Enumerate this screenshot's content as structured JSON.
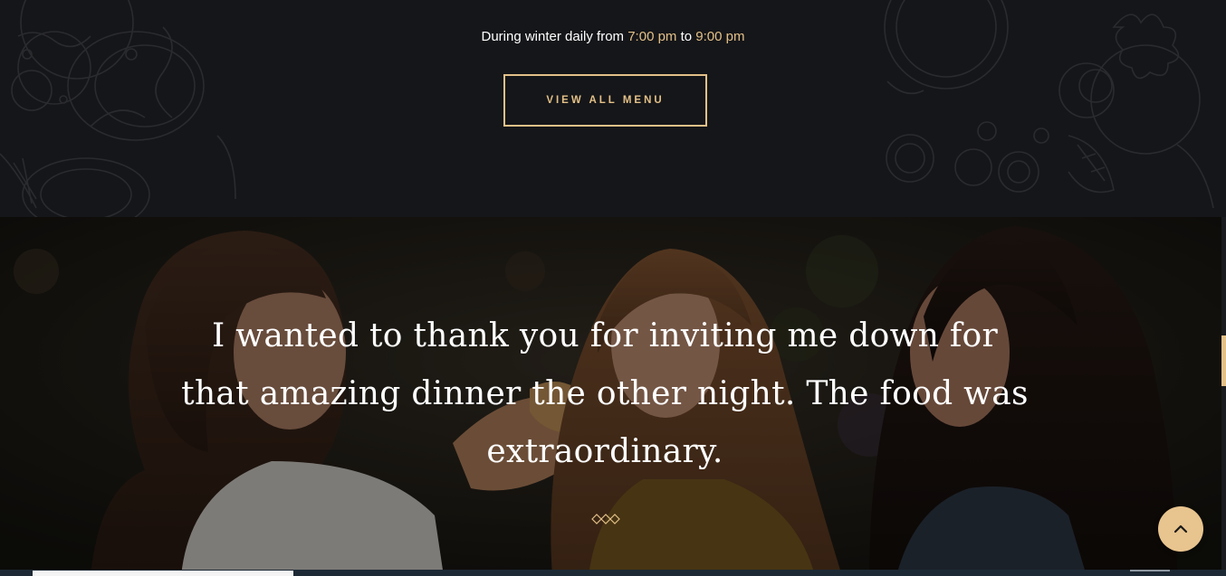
{
  "menu_section": {
    "hours_prefix": "During winter daily from ",
    "hours_start": "7:00 pm",
    "hours_middle": " to ",
    "hours_end": "9:00 pm",
    "button_label": "VIEW ALL MENU"
  },
  "testimonial": {
    "quote": "I wanted to thank you for inviting me down for that amazing dinner the other night. The food was extraordinary."
  },
  "colors": {
    "accent": "#e3c088",
    "dark_background": "#151619",
    "text": "#ffffff"
  },
  "icons": {
    "back_to_top": "chevron-up-icon",
    "divider": "diamond-divider-icon"
  }
}
